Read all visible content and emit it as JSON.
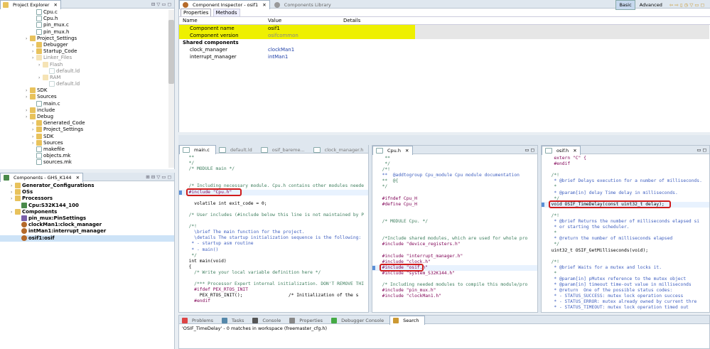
{
  "project_explorer": {
    "title": "Project Explorer",
    "items": [
      {
        "t": "f",
        "d": 3,
        "label": "Cpu.c"
      },
      {
        "t": "f",
        "d": 3,
        "label": "Cpu.h"
      },
      {
        "t": "f",
        "d": 3,
        "label": "pin_mux.c"
      },
      {
        "t": "f",
        "d": 3,
        "label": "pin_mux.h"
      },
      {
        "t": "d",
        "d": 2,
        "label": "Project_Settings"
      },
      {
        "t": "d",
        "d": 3,
        "label": "Debugger"
      },
      {
        "t": "d",
        "d": 3,
        "label": "Startup_Code"
      },
      {
        "t": "d",
        "d": 3,
        "label": "Linker_Files",
        "g": true
      },
      {
        "t": "d",
        "d": 4,
        "label": "Flash",
        "g": true
      },
      {
        "t": "f",
        "d": 5,
        "label": "default.ld",
        "g": true
      },
      {
        "t": "d",
        "d": 4,
        "label": "RAM",
        "g": true
      },
      {
        "t": "f",
        "d": 5,
        "label": "default.ld",
        "g": true
      },
      {
        "t": "d",
        "d": 2,
        "label": "SDK"
      },
      {
        "t": "d",
        "d": 2,
        "label": "Sources"
      },
      {
        "t": "f",
        "d": 3,
        "label": "main.c"
      },
      {
        "t": "d",
        "d": 2,
        "label": "include"
      },
      {
        "t": "d",
        "d": 2,
        "label": "Debug"
      },
      {
        "t": "d",
        "d": 3,
        "label": "Generated_Code"
      },
      {
        "t": "d",
        "d": 3,
        "label": "Project_Settings"
      },
      {
        "t": "d",
        "d": 3,
        "label": "SDK"
      },
      {
        "t": "d",
        "d": 3,
        "label": "Sources"
      },
      {
        "t": "f",
        "d": 3,
        "label": "makefile"
      },
      {
        "t": "f",
        "d": 3,
        "label": "objects.mk"
      },
      {
        "t": "f",
        "d": 3,
        "label": "sources.mk"
      }
    ]
  },
  "components": {
    "title": "Components - GHS_K144",
    "items": [
      {
        "t": "d",
        "d": 1,
        "label": "Generator_Configurations",
        "b": true
      },
      {
        "t": "d",
        "d": 1,
        "label": "OSs",
        "b": true
      },
      {
        "t": "d",
        "d": 1,
        "label": "Processors",
        "b": true
      },
      {
        "t": "c",
        "d": 2,
        "label": "Cpu:S32K144_100",
        "b": true
      },
      {
        "t": "d",
        "d": 1,
        "label": "Components",
        "b": true
      },
      {
        "t": "p",
        "d": 2,
        "label": "pin_mux:PinSettings",
        "b": true
      },
      {
        "t": "g",
        "d": 2,
        "label": "clockMan1:clock_manager",
        "b": true
      },
      {
        "t": "g",
        "d": 2,
        "label": "intMan1:interrupt_manager",
        "b": true
      },
      {
        "t": "g",
        "d": 2,
        "label": "osif1:osif",
        "b": true,
        "sel": true
      }
    ]
  },
  "inspector": {
    "title": "Component Inspector - osif1",
    "tab2": "Components Library",
    "mode_basic": "Basic",
    "mode_adv": "Advanced",
    "tabs": [
      "Properties",
      "Methods"
    ],
    "cols": [
      "Name",
      "Value",
      "Details"
    ],
    "rows": [
      {
        "name": "Component name",
        "value": "osif1",
        "hl": true,
        "d": 1
      },
      {
        "name": "Component version",
        "value": "osifcommon",
        "hl": true,
        "d": 1,
        "dim": true
      },
      {
        "name": "Shared components",
        "value": "",
        "d": 0,
        "bold": true
      },
      {
        "name": "clock_manager",
        "value": "clockMan1",
        "d": 1,
        "link": true
      },
      {
        "name": "interrupt_manager",
        "value": "intMan1",
        "d": 1,
        "link": true
      }
    ]
  },
  "editor1": {
    "tabs": [
      "main.c",
      "default.ld",
      "osif_bareme...",
      "clock_manager.h",
      "»2"
    ],
    "lines": [
      [
        "c",
        "  **"
      ],
      [
        "c",
        "  */"
      ],
      [
        "c",
        "  /* MODULE main */"
      ],
      [
        "c",
        ""
      ],
      [
        "c",
        ""
      ],
      [
        "c",
        "  /* Including necessary module. Cpu.h contains other modules neede"
      ],
      [
        "i",
        "  #include \"Cpu.h\""
      ],
      [
        "c",
        ""
      ],
      [
        "v",
        "    volatile int exit_code = 0;"
      ],
      [
        "c",
        ""
      ],
      [
        "c",
        "  /* User includes (#include below this line is not maintained by P"
      ],
      [
        "c",
        ""
      ],
      [
        "c",
        "  /*!"
      ],
      [
        "d",
        "    \\brief The main function for the project."
      ],
      [
        "d",
        "    \\details The startup initialization sequence is the following:"
      ],
      [
        "d",
        "   * - startup asm routine"
      ],
      [
        "d",
        "   * - main()"
      ],
      [
        "c",
        "   */"
      ],
      [
        "m",
        "  int main(void)"
      ],
      [
        "b",
        "  {"
      ],
      [
        "c",
        "    /* Write your local variable definition here */"
      ],
      [
        "c",
        ""
      ],
      [
        "c",
        "    /*** Processor Expert internal initialization. DON'T REMOVE THI"
      ],
      [
        "p",
        "    #ifdef PEX_RTOS_INIT"
      ],
      [
        "q",
        "      PEX_RTOS_INIT();                 /* Initialization of the s"
      ],
      [
        "p",
        "    #endif"
      ]
    ]
  },
  "editor2": {
    "tab": "Cpu.h",
    "lines": [
      [
        "c",
        "   **"
      ],
      [
        "c",
        "   */"
      ],
      [
        "c",
        "  /*!"
      ],
      [
        "d",
        "  **  @addtogroup Cpu_module Cpu module documentation"
      ],
      [
        "c",
        "  **  @{"
      ],
      [
        "c",
        "  */"
      ],
      [
        "c",
        ""
      ],
      [
        "p",
        "  #ifndef Cpu_H"
      ],
      [
        "p",
        "  #define Cpu_H"
      ],
      [
        "c",
        ""
      ],
      [
        "c",
        ""
      ],
      [
        "c",
        "  /* MODULE Cpu. */"
      ],
      [
        "c",
        ""
      ],
      [
        "c",
        ""
      ],
      [
        "c",
        "  /*Include shared modules, which are used for whole pro"
      ],
      [
        "i",
        "  #include \"device_registers.h\""
      ],
      [
        "c",
        ""
      ],
      [
        "i",
        "  #include \"interrupt_manager.h\""
      ],
      [
        "i",
        "  #include \"clock.h\""
      ],
      [
        "x",
        "  #include \"osif.h\""
      ],
      [
        "i",
        "  #include \"system_S32K144.h\""
      ],
      [
        "c",
        ""
      ],
      [
        "c",
        "  /* Including needed modules to compile this module/pro"
      ],
      [
        "i",
        "  #include \"pin_mux.h\""
      ],
      [
        "i",
        "  #include \"clockMan1.h\""
      ]
    ]
  },
  "editor3": {
    "tab": "osif.h",
    "lines": [
      [
        "p",
        "   extern \"C\" {"
      ],
      [
        "p",
        "   #endif"
      ],
      [
        "c",
        ""
      ],
      [
        "c",
        "  /*!"
      ],
      [
        "d",
        "   * @brief Delays execution for a number of milliseconds."
      ],
      [
        "c",
        "   *"
      ],
      [
        "d",
        "   * @param[in] delay Time delay in milliseconds."
      ],
      [
        "c",
        "   */"
      ],
      [
        "z",
        "  void OSIF_TimeDelay(const uint32_t delay);"
      ],
      [
        "c",
        ""
      ],
      [
        "c",
        "  /*!"
      ],
      [
        "d",
        "   * @brief Returns the number of milliseconds elapsed si"
      ],
      [
        "d",
        "   * or starting the scheduler."
      ],
      [
        "c",
        "   *"
      ],
      [
        "d",
        "   * @return the number of milliseconds elapsed"
      ],
      [
        "c",
        "   */"
      ],
      [
        "b",
        "  uint32_t OSIF_GetMilliseconds(void);"
      ],
      [
        "c",
        ""
      ],
      [
        "c",
        "  /*!"
      ],
      [
        "d",
        "   * @brief Waits for a mutex and locks it."
      ],
      [
        "c",
        "   *"
      ],
      [
        "d",
        "   * @param[in] pMutex reference to the mutex object"
      ],
      [
        "d",
        "   * @param[in] timeout time-out value in milliseconds"
      ],
      [
        "d",
        "   * @return  One of the possible status codes:"
      ],
      [
        "d",
        "   * - STATUS_SUCCESS: mutex lock operation success"
      ],
      [
        "d",
        "   * - STATUS_ERROR: mutex already owned by current thre"
      ],
      [
        "d",
        "   * - STATUS_TIMEOUT: mutex lock operation timed out"
      ]
    ]
  },
  "bottom": {
    "tabs": [
      "Problems",
      "Tasks",
      "Console",
      "Properties",
      "Debugger Console",
      "Search"
    ],
    "active": 5,
    "status": "'OSIF_TimeDelay' - 0 matches in workspace (freemaster_cfg.h)"
  }
}
